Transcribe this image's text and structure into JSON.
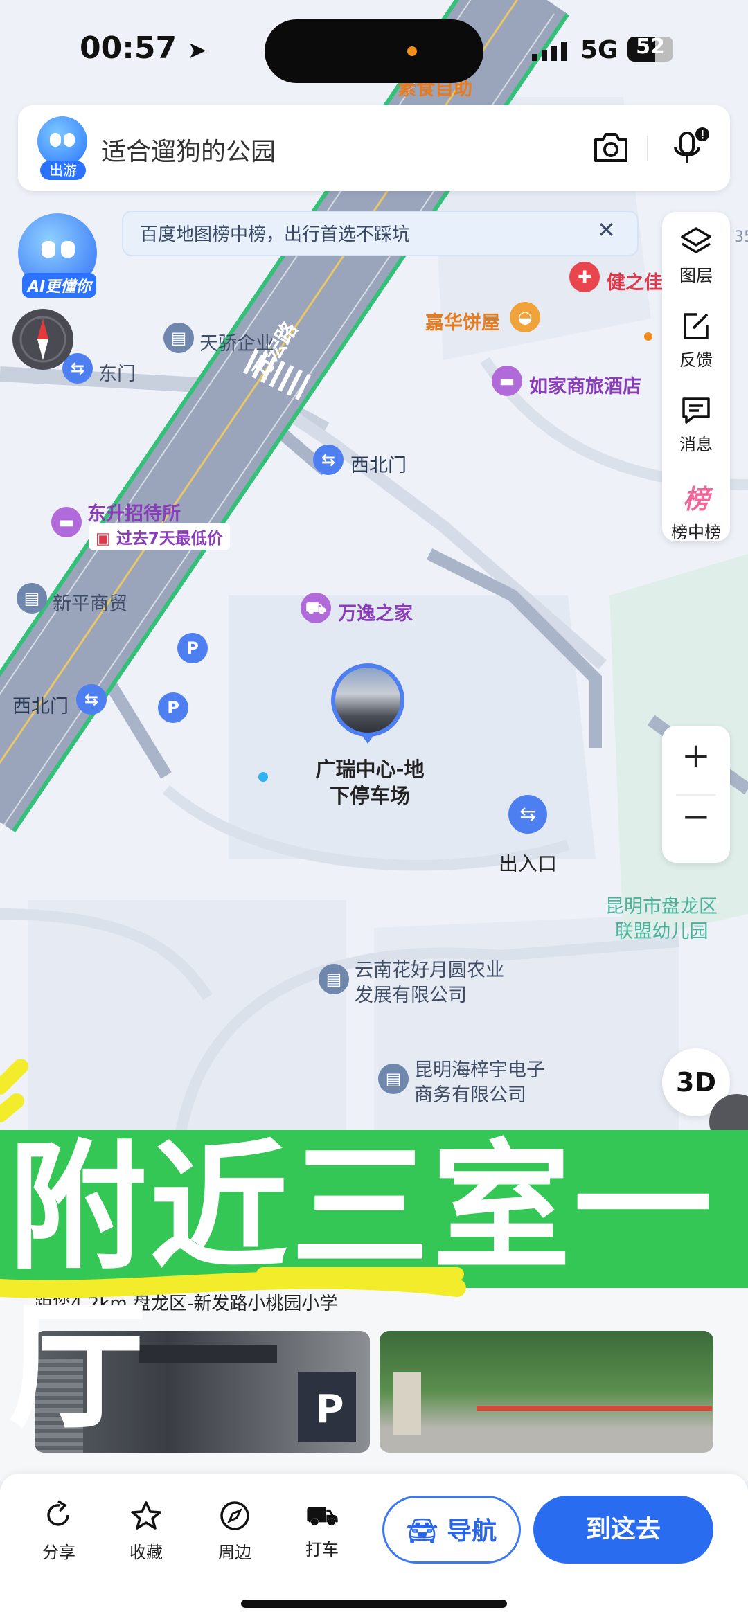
{
  "status_bar": {
    "time": "00:57",
    "network": "5G",
    "battery": "52"
  },
  "search": {
    "badge": "出游",
    "query": "适合遛狗的公园"
  },
  "notice": {
    "text": "百度地图榜中榜，出行首选不踩坑",
    "close": "✕"
  },
  "ai_assistant": {
    "label": "AI更懂你"
  },
  "toolbar": {
    "layers": "图层",
    "feedback": "反馈",
    "messages": "消息",
    "rankings": "榜中榜",
    "rank_glyph": "榜"
  },
  "map": {
    "road": "万宏路",
    "poi": {
      "top_partial": "素食自助",
      "tianjiao": "天骄企业",
      "dongmen": "东门",
      "xibeimen1": "西北门",
      "jianzhijia": "健之佳",
      "jiahua": "嘉华饼屋",
      "rujia": "如家商旅酒店",
      "dongsheng": "东升招待所",
      "dongsheng_deal": "过去7天最低价",
      "xinping": "新平商贸",
      "wanyi": "万逸之家",
      "xibeimen2": "西北门",
      "guangrui_line1": "广瑞中心-地",
      "guangrui_line2": "下停车场",
      "entrance": "出入口",
      "kindergarten_line1": "昆明市盘龙区",
      "kindergarten_line2": "联盟幼儿园",
      "yunnan_line1": "云南花好月圆农业",
      "yunnan_line2": "发展有限公司",
      "haizi_line1": "昆明海梓宇电子",
      "haizi_line2": "商务有限公司",
      "right_edge": "35"
    }
  },
  "zoom": {
    "plus": "+",
    "minus": "−"
  },
  "view_3d": "3D",
  "banner": {
    "headline": "附近三室一厅"
  },
  "detail": {
    "distance_line": "距您4.2km  盘龙区-新发路小桃园小学"
  },
  "bottom_bar": {
    "share": "分享",
    "favorite": "收藏",
    "nearby": "周边",
    "taxi": "打车",
    "navigate": "导航",
    "go_here": "到这去"
  },
  "colors": {
    "accent": "#2a6cf0",
    "banner_green": "#34c755",
    "road_green": "#35c07a"
  }
}
